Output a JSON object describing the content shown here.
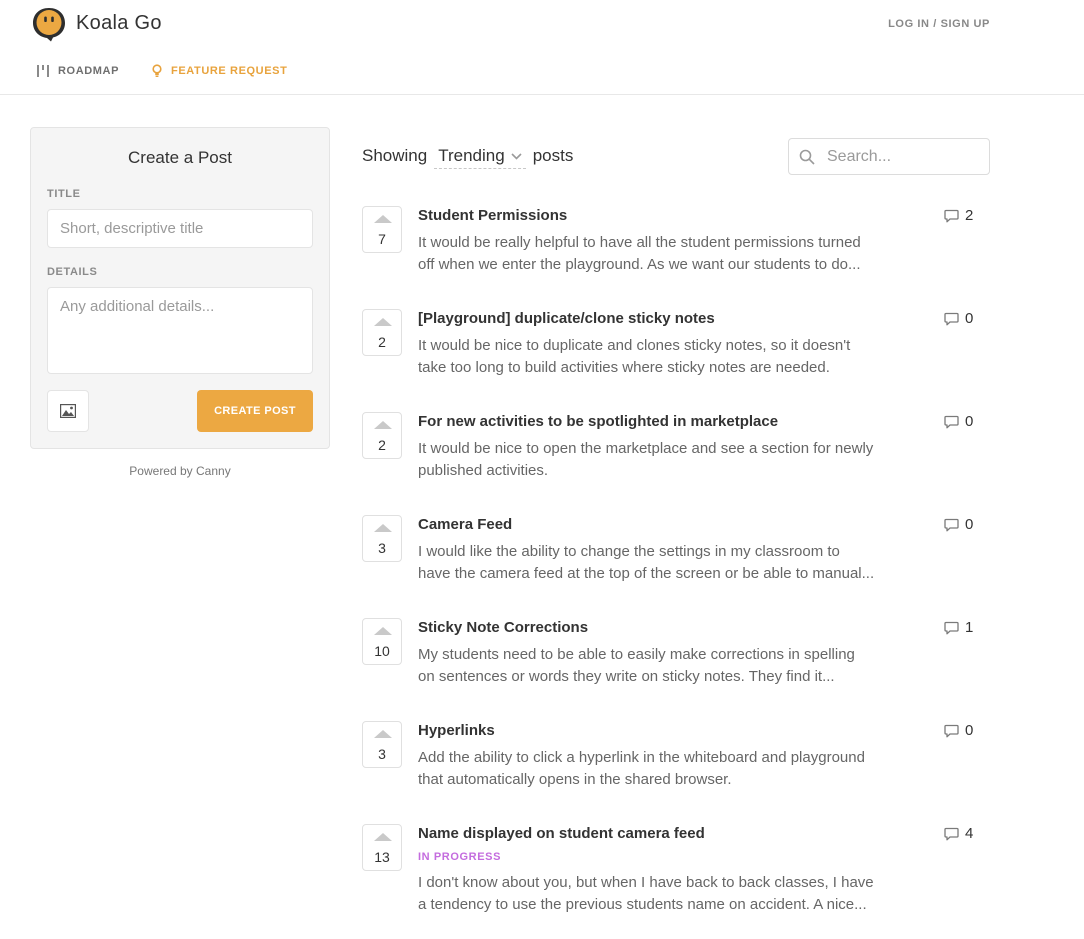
{
  "header": {
    "brand": "Koala Go",
    "login_label": "LOG IN / SIGN UP",
    "nav": [
      {
        "label": "ROADMAP",
        "icon": "roadmap-icon",
        "active": false
      },
      {
        "label": "FEATURE REQUEST",
        "icon": "lightbulb-icon",
        "active": true
      }
    ]
  },
  "colors": {
    "accent": "#eca842",
    "in_progress": "#c46cde"
  },
  "create_post": {
    "heading": "Create a Post",
    "title_label": "TITLE",
    "title_placeholder": "Short, descriptive title",
    "details_label": "DETAILS",
    "details_placeholder": "Any additional details...",
    "image_button_icon": "image-icon",
    "submit_label": "CREATE POST"
  },
  "powered_by": "Powered by Canny",
  "feed": {
    "showing_prefix": "Showing",
    "sort_value": "Trending",
    "showing_suffix": "posts",
    "search_placeholder": "Search..."
  },
  "posts": [
    {
      "votes": "7",
      "title": "Student Permissions",
      "status": "",
      "comments": "2",
      "desc": [
        "It would be really helpful to have all the student permissions turned",
        "off when we enter the playground. As we want our students to do..."
      ]
    },
    {
      "votes": "2",
      "title": "[Playground] duplicate/clone sticky notes",
      "status": "",
      "comments": "0",
      "desc": [
        "It would be nice to duplicate and clones sticky notes, so it doesn't",
        "take too long to build activities where sticky notes are needed."
      ]
    },
    {
      "votes": "2",
      "title": "For new activities to be spotlighted in marketplace",
      "status": "",
      "comments": "0",
      "desc": [
        "It would be nice to open the marketplace and see a section for newly",
        "published activities."
      ]
    },
    {
      "votes": "3",
      "title": "Camera Feed",
      "status": "",
      "comments": "0",
      "desc": [
        "I would like the ability to change the settings in my classroom to",
        "have the camera feed at the top of the screen or be able to manual..."
      ]
    },
    {
      "votes": "10",
      "title": "Sticky Note Corrections",
      "status": "",
      "comments": "1",
      "desc": [
        "My students need to be able to easily make corrections in spelling",
        "on sentences or words they write on sticky notes. They find it..."
      ]
    },
    {
      "votes": "3",
      "title": "Hyperlinks",
      "status": "",
      "comments": "0",
      "desc": [
        "Add the ability to click a hyperlink in the whiteboard and playground",
        "that automatically opens in the shared browser."
      ]
    },
    {
      "votes": "13",
      "title": "Name displayed on student camera feed",
      "status": "IN PROGRESS",
      "comments": "4",
      "desc": [
        "I don't know about you, but when I have back to back classes, I have",
        "a tendency to use the previous students name on accident. A nice..."
      ]
    }
  ]
}
